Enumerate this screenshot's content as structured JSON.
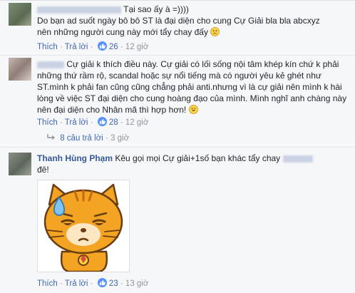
{
  "comments": [
    {
      "author_text": "Tại sao ấy à =))))",
      "body": "Do bạn ad suốt ngày bô bô ST là đại diện cho cung Cự Giải bla bla abcxyz nên những người cung này mới tẩy chay đấy",
      "emoji_icon": "disappointed-face",
      "like_label": "Thích",
      "reply_label": "Trả lời",
      "likes": "26",
      "time": "12 giờ"
    },
    {
      "body": "Cự giải k thích điều này. Cự giải có lối sống nội tâm khép kín chứ k phải những thứ rầm rộ, scandal hoặc sự nổi tiếng mà có người yêu kẻ ghét như ST.mình k phải fan cũng cũng chẳng phải anti.nhưng vì là cự giải nên mình k hài lòng về việc ST đại diện cho cung hoàng đạo của mình. Mình nghĩ anh chàng này nên đại diện cho Nhân mã thì hợp hơn!",
      "emoji_icon": "grinning-face",
      "like_label": "Thích",
      "reply_label": "Trả lời",
      "likes": "28",
      "time": "12 giờ",
      "replies_label": "8 câu trả lời",
      "replies_time": "3 giờ"
    },
    {
      "author": "Thanh Hùng Phạm",
      "body_before": "Kêu gọi mọi Cự giải+1số bạn khác tẩy chay",
      "body_after": "đê!",
      "like_label": "Thích",
      "reply_label": "Trả lời",
      "likes": "23",
      "time": "13 giờ"
    }
  ],
  "colors": {
    "link": "#4267b2",
    "name": "#365899",
    "meta": "#90949c",
    "like_badge": "#5890ff",
    "sticker_cat": "#f3a423"
  }
}
